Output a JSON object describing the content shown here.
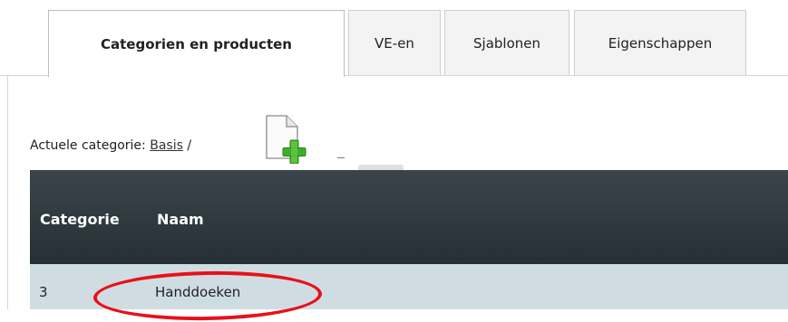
{
  "tabs": [
    {
      "label": "Categorien en producten",
      "active": true
    },
    {
      "label": "VE-en",
      "active": false
    },
    {
      "label": "Sjablonen",
      "active": false
    },
    {
      "label": "Eigenschappen",
      "active": false
    }
  ],
  "breadcrumb": {
    "prefix": "Actuele categorie:",
    "link": "Basis",
    "separator": "/"
  },
  "toolbar": {
    "add_icon": "add-document-icon"
  },
  "table": {
    "columns": [
      "Categorie",
      "Naam"
    ],
    "rows": [
      {
        "categorie": "3",
        "naam": "Handdoeken"
      }
    ]
  },
  "colors": {
    "header_bg": "#2c363b",
    "row_bg": "#cfdde3",
    "annotation": "#e8101a",
    "plus": "#3fae2a"
  }
}
